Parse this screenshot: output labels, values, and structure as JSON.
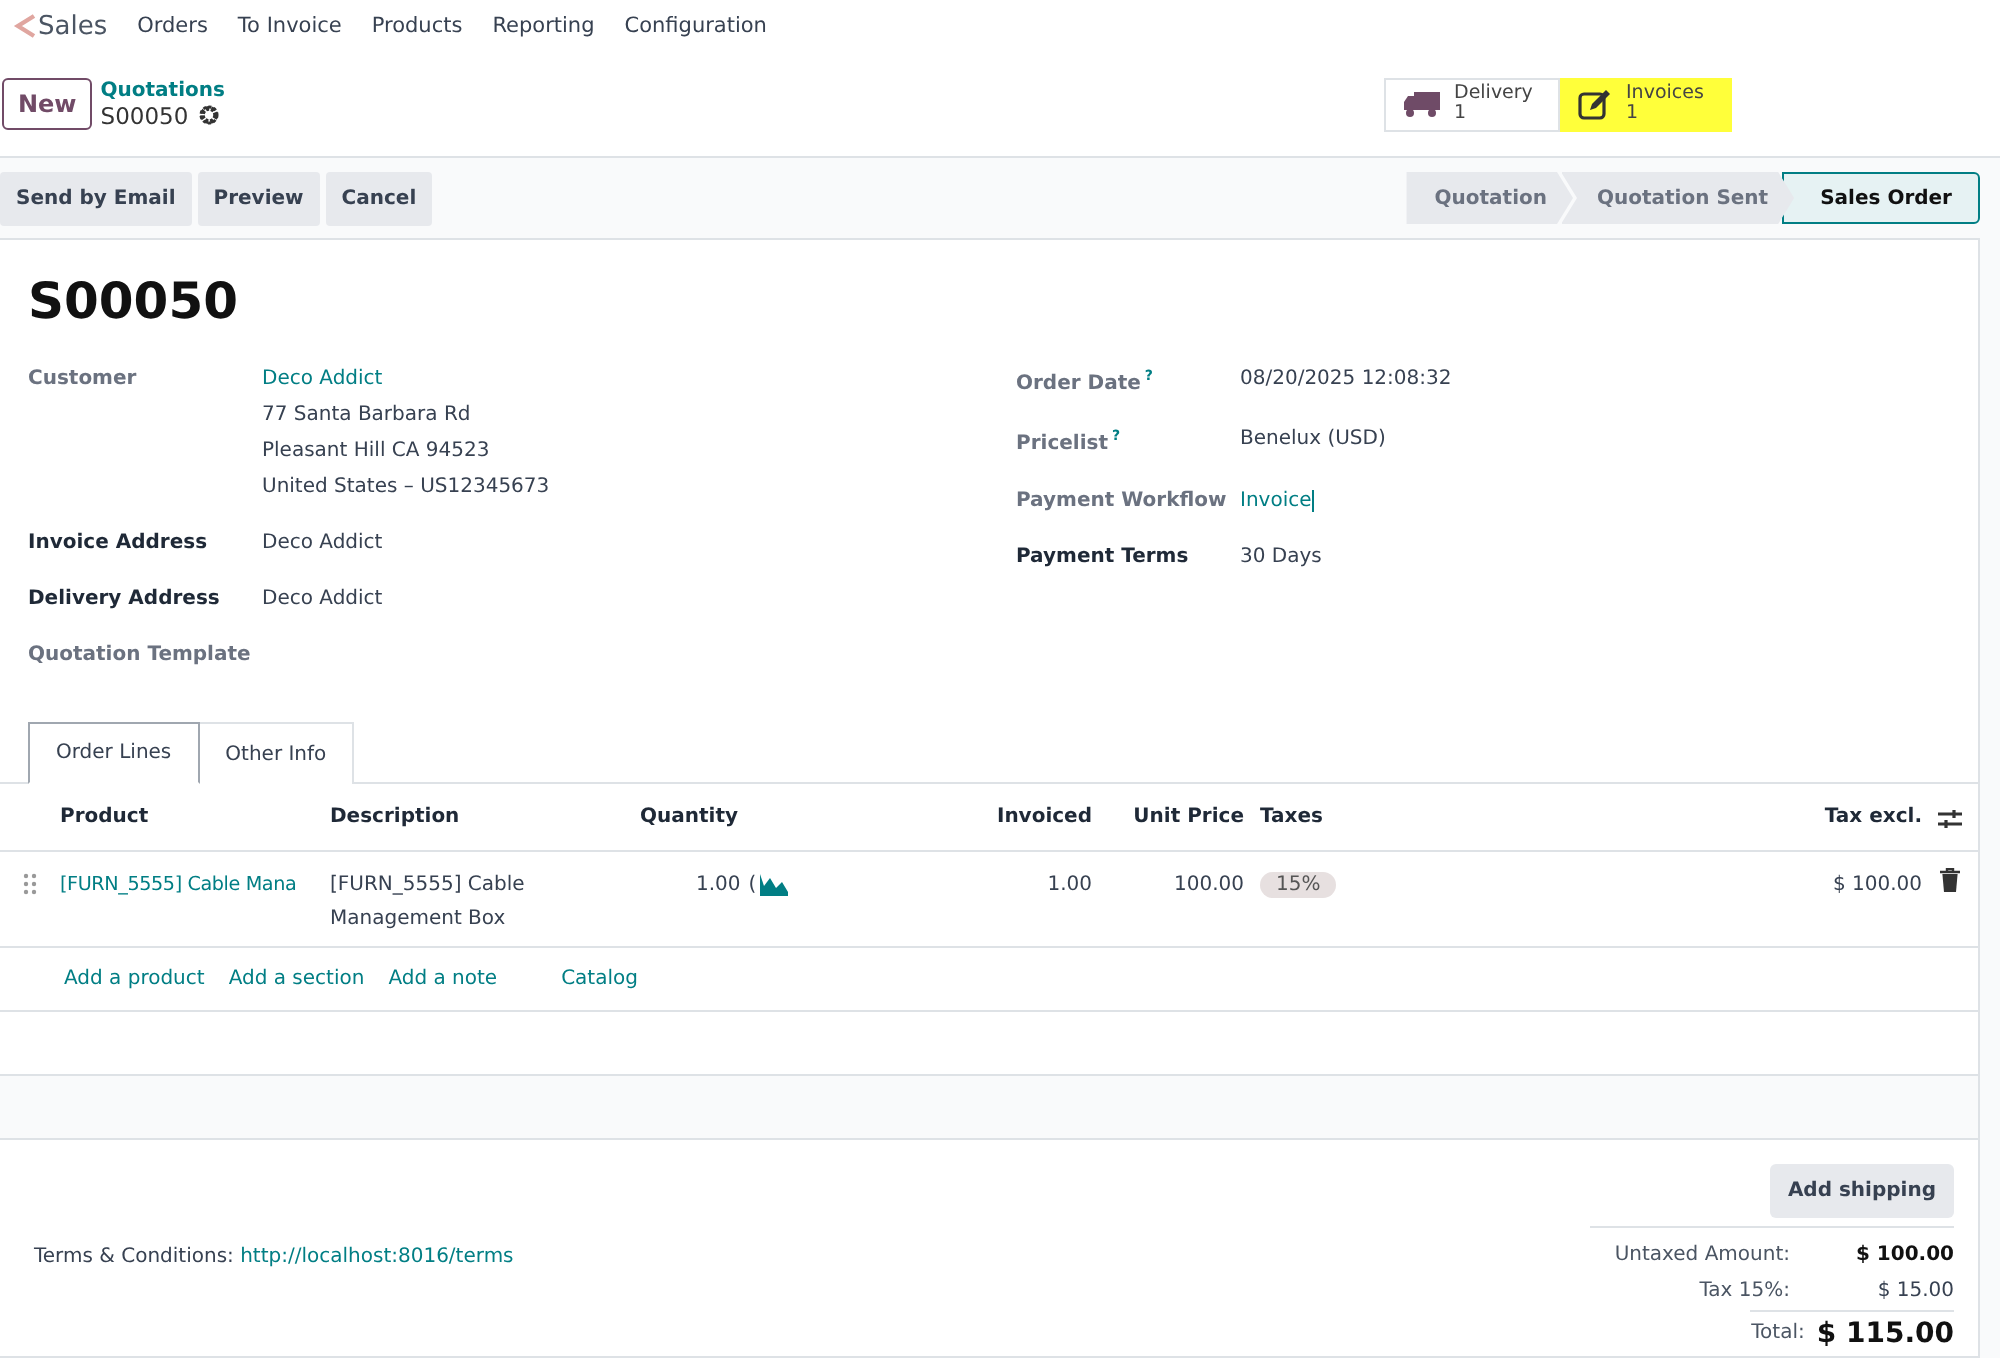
{
  "nav": {
    "app": "Sales",
    "menus": [
      "Orders",
      "To Invoice",
      "Products",
      "Reporting",
      "Configuration"
    ]
  },
  "breadcrumb": {
    "new_button": "New",
    "parent": "Quotations",
    "current": "S00050"
  },
  "smart_buttons": [
    {
      "kind": "delivery",
      "label": "Delivery",
      "count": "1",
      "highlighted": false
    },
    {
      "kind": "invoices",
      "label": "Invoices",
      "count": "1",
      "highlighted": true
    }
  ],
  "actions": [
    "Send by Email",
    "Preview",
    "Cancel"
  ],
  "statusbar": [
    {
      "label": "Quotation",
      "selected": false
    },
    {
      "label": "Quotation Sent",
      "selected": false
    },
    {
      "label": "Sales Order",
      "selected": true
    }
  ],
  "title": "S00050",
  "left_fields": [
    {
      "label": "Customer",
      "bold": false,
      "value": "Deco Addict",
      "link": true,
      "address": [
        "77 Santa Barbara Rd",
        "Pleasant Hill CA 94523",
        "United States – US12345673"
      ]
    },
    {
      "label": "Invoice Address",
      "bold": true,
      "value": "Deco Addict",
      "link": false
    },
    {
      "label": "Delivery Address",
      "bold": true,
      "value": "Deco Addict",
      "link": false
    },
    {
      "label": "Quotation Template",
      "bold": false
    }
  ],
  "right_fields": [
    {
      "label": "Order Date",
      "help": "?",
      "bold": false,
      "value": "08/20/2025 12:08:32",
      "link": false
    },
    {
      "label": "Pricelist",
      "help": "?",
      "bold": false,
      "value": "Benelux (USD)",
      "link": false
    },
    {
      "label": "Payment Workflow",
      "bold": false,
      "value": "Invoice",
      "link": true
    },
    {
      "label": "Payment Terms",
      "bold": true,
      "value": "30 Days",
      "link": false
    }
  ],
  "tabs": [
    {
      "label": "Order Lines",
      "selected": true
    },
    {
      "label": "Other Info",
      "selected": false
    }
  ],
  "table": {
    "columns": [
      "Product",
      "Description",
      "Quantity",
      "Invoiced",
      "Unit Price",
      "Taxes",
      "Tax excl."
    ],
    "rows": [
      {
        "product": "[FURN_5555] Cable Mana",
        "description": "[FURN_5555] Cable Management Box",
        "quantity": "1.00",
        "quantity_cut": "(",
        "invoiced": "1.00",
        "unit_price": "100.00",
        "taxes": "15%",
        "subtotal": "$ 100.00"
      }
    ],
    "add_links": [
      "Add a product",
      "Add a section",
      "Add a note",
      "Catalog"
    ]
  },
  "footer": {
    "terms_label": "Terms & Conditions:",
    "terms_link": "http://localhost:8016/terms",
    "shipping_button": "Add shipping",
    "totals": [
      {
        "label": "Untaxed Amount:",
        "value": "$ 100.00",
        "kind": "bold"
      },
      {
        "label": "Tax 15%:",
        "value": "$ 15.00",
        "kind": "plain"
      },
      {
        "label": "Total:",
        "value": "$ 115.00",
        "kind": "grand"
      }
    ]
  }
}
